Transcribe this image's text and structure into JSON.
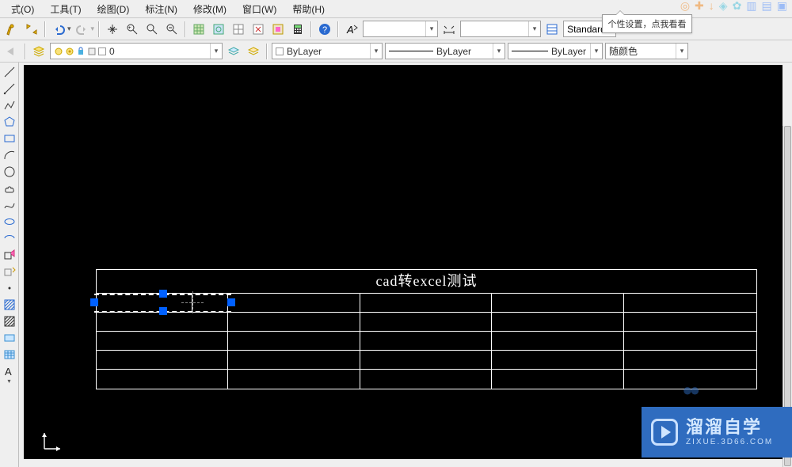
{
  "menu": {
    "format": "式(O)",
    "tools": "工具(T)",
    "draw": "绘图(D)",
    "dimension": "标注(N)",
    "modify": "修改(M)",
    "window": "窗口(W)",
    "help": "帮助(H)"
  },
  "balloon": "个性设置，点我看看",
  "toolbar1": {
    "text_style": "Standard"
  },
  "toolbar2": {
    "layer_current": "0",
    "color_sel": "ByLayer",
    "linetype_sel": "ByLayer",
    "lineweight_sel": "ByLayer",
    "plot_color": "随颜色"
  },
  "drawing": {
    "title": "cad转excel测试"
  },
  "watermark": {
    "main": "溜溜自学",
    "sub": "ZIXUE.3D66.COM"
  },
  "chart_data": {
    "type": "table",
    "title": "cad转excel测试",
    "columns": 5,
    "body_rows": 5,
    "notes": "CAD table object shown in model space; header row contains title spanning all columns, body cells are empty. An extra vertical divider is visible inside the first column of the first body row. A separate dashed line object with three grips (and its mirror dashed copy) is selected near the top-left of the table."
  }
}
